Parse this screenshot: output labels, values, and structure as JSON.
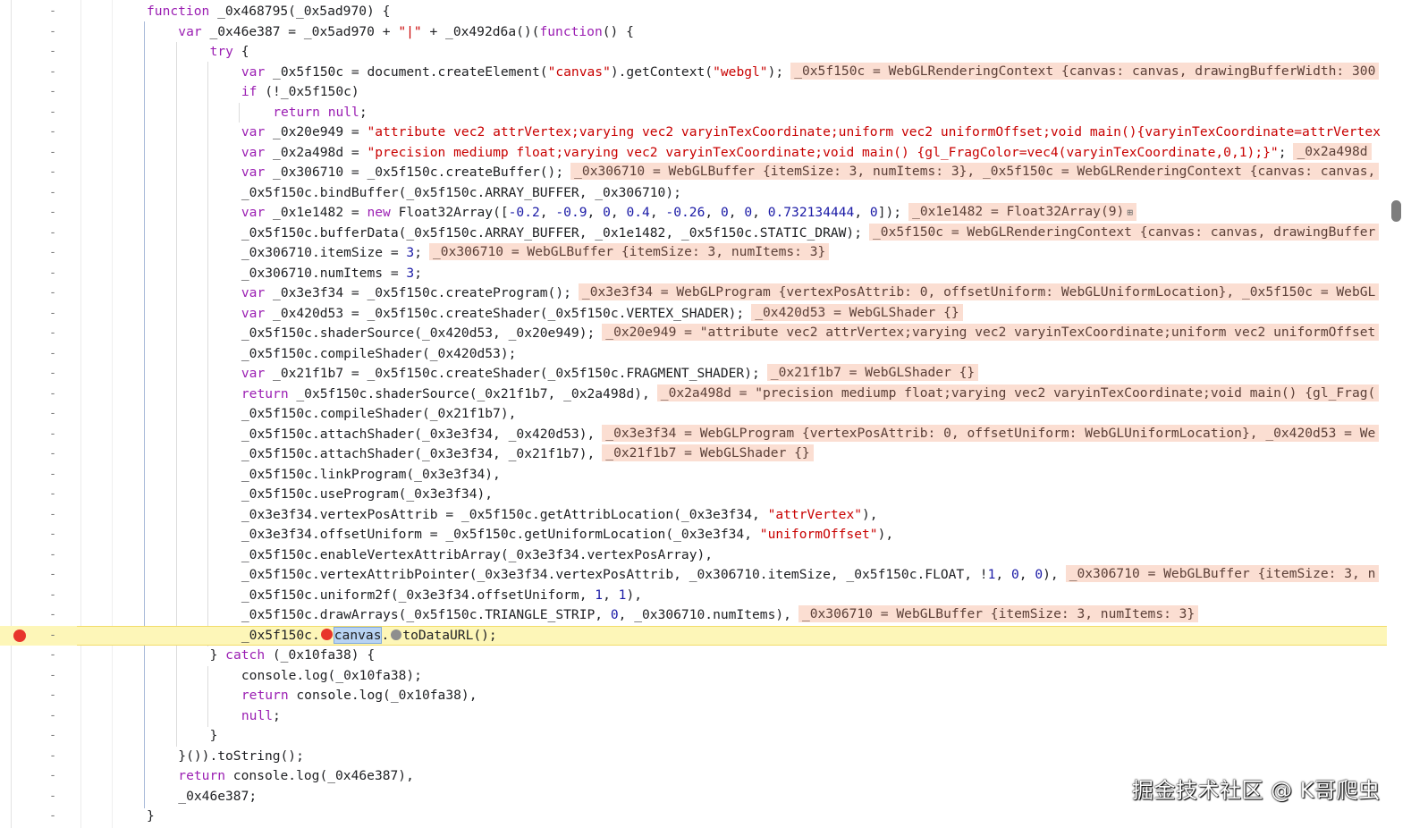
{
  "editor": {
    "paused_line_index": 31,
    "lines": [
      {
        "indent": 0,
        "marker": "-",
        "tokens": [
          {
            "k": "k",
            "t": "function"
          },
          {
            "k": "p",
            "t": " _0x468795(_0x5ad970) {"
          }
        ],
        "inline": null
      },
      {
        "indent": 1,
        "marker": "-",
        "tokens": [
          {
            "k": "k",
            "t": "var"
          },
          {
            "k": "p",
            "t": " _0x46e387 = _0x5ad970 + "
          },
          {
            "k": "s",
            "t": "\"|\""
          },
          {
            "k": "p",
            "t": " + _0x492d6a()("
          },
          {
            "k": "k",
            "t": "function"
          },
          {
            "k": "p",
            "t": "() {"
          }
        ],
        "inline": null
      },
      {
        "indent": 2,
        "marker": "-",
        "tokens": [
          {
            "k": "k",
            "t": "try"
          },
          {
            "k": "p",
            "t": " {"
          }
        ],
        "inline": null
      },
      {
        "indent": 3,
        "marker": "-",
        "tokens": [
          {
            "k": "k",
            "t": "var"
          },
          {
            "k": "p",
            "t": " _0x5f150c = document.createElement("
          },
          {
            "k": "s",
            "t": "\"canvas\""
          },
          {
            "k": "p",
            "t": ").getContext("
          },
          {
            "k": "s",
            "t": "\"webgl\""
          },
          {
            "k": "p",
            "t": ");"
          }
        ],
        "inline": "_0x5f150c = WebGLRenderingContext {canvas: canvas, drawingBufferWidth: 300"
      },
      {
        "indent": 3,
        "marker": "-",
        "tokens": [
          {
            "k": "k",
            "t": "if"
          },
          {
            "k": "p",
            "t": " (!_0x5f150c)"
          }
        ],
        "inline": null
      },
      {
        "indent": 4,
        "marker": "-",
        "tokens": [
          {
            "k": "k",
            "t": "return"
          },
          {
            "k": "p",
            "t": " "
          },
          {
            "k": "k",
            "t": "null"
          },
          {
            "k": "p",
            "t": ";"
          }
        ],
        "inline": null
      },
      {
        "indent": 3,
        "marker": "-",
        "tokens": [
          {
            "k": "k",
            "t": "var"
          },
          {
            "k": "p",
            "t": " _0x20e949 = "
          },
          {
            "k": "s",
            "t": "\"attribute vec2 attrVertex;varying vec2 varyinTexCoordinate;uniform vec2 uniformOffset;void main(){varyinTexCoordinate=attrVertex"
          }
        ],
        "inline": null
      },
      {
        "indent": 3,
        "marker": "-",
        "tokens": [
          {
            "k": "k",
            "t": "var"
          },
          {
            "k": "p",
            "t": " _0x2a498d = "
          },
          {
            "k": "s",
            "t": "\"precision mediump float;varying vec2 varyinTexCoordinate;void main() {gl_FragColor=vec4(varyinTexCoordinate,0,1);}\""
          },
          {
            "k": "p",
            "t": ";"
          }
        ],
        "inline": "_0x2a498d"
      },
      {
        "indent": 3,
        "marker": "-",
        "tokens": [
          {
            "k": "k",
            "t": "var"
          },
          {
            "k": "p",
            "t": " _0x306710 = _0x5f150c.createBuffer();"
          }
        ],
        "inline": "_0x306710 = WebGLBuffer {itemSize: 3, numItems: 3}, _0x5f150c = WebGLRenderingContext {canvas: canvas,"
      },
      {
        "indent": 3,
        "marker": "-",
        "tokens": [
          {
            "k": "p",
            "t": "_0x5f150c.bindBuffer(_0x5f150c.ARRAY_BUFFER, _0x306710);"
          }
        ],
        "inline": null
      },
      {
        "indent": 3,
        "marker": "-",
        "tokens": [
          {
            "k": "k",
            "t": "var"
          },
          {
            "k": "p",
            "t": " _0x1e1482 = "
          },
          {
            "k": "k",
            "t": "new"
          },
          {
            "k": "p",
            "t": " Float32Array(["
          },
          {
            "k": "n",
            "t": "-0.2"
          },
          {
            "k": "p",
            "t": ", "
          },
          {
            "k": "n",
            "t": "-0.9"
          },
          {
            "k": "p",
            "t": ", "
          },
          {
            "k": "n",
            "t": "0"
          },
          {
            "k": "p",
            "t": ", "
          },
          {
            "k": "n",
            "t": "0.4"
          },
          {
            "k": "p",
            "t": ", "
          },
          {
            "k": "n",
            "t": "-0.26"
          },
          {
            "k": "p",
            "t": ", "
          },
          {
            "k": "n",
            "t": "0"
          },
          {
            "k": "p",
            "t": ", "
          },
          {
            "k": "n",
            "t": "0"
          },
          {
            "k": "p",
            "t": ", "
          },
          {
            "k": "n",
            "t": "0.732134444"
          },
          {
            "k": "p",
            "t": ", "
          },
          {
            "k": "n",
            "t": "0"
          },
          {
            "k": "p",
            "t": "]);"
          }
        ],
        "inline": "_0x1e1482 = Float32Array(9)",
        "inline_icon": "⊞"
      },
      {
        "indent": 3,
        "marker": "-",
        "tokens": [
          {
            "k": "p",
            "t": "_0x5f150c.bufferData(_0x5f150c.ARRAY_BUFFER, _0x1e1482, _0x5f150c.STATIC_DRAW);"
          }
        ],
        "inline": "_0x5f150c = WebGLRenderingContext {canvas: canvas, drawingBuffer"
      },
      {
        "indent": 3,
        "marker": "-",
        "tokens": [
          {
            "k": "p",
            "t": "_0x306710.itemSize = "
          },
          {
            "k": "n",
            "t": "3"
          },
          {
            "k": "p",
            "t": ";"
          }
        ],
        "inline": "_0x306710 = WebGLBuffer {itemSize: 3, numItems: 3}"
      },
      {
        "indent": 3,
        "marker": "-",
        "tokens": [
          {
            "k": "p",
            "t": "_0x306710.numItems = "
          },
          {
            "k": "n",
            "t": "3"
          },
          {
            "k": "p",
            "t": ";"
          }
        ],
        "inline": null
      },
      {
        "indent": 3,
        "marker": "-",
        "tokens": [
          {
            "k": "k",
            "t": "var"
          },
          {
            "k": "p",
            "t": " _0x3e3f34 = _0x5f150c.createProgram();"
          }
        ],
        "inline": "_0x3e3f34 = WebGLProgram {vertexPosAttrib: 0, offsetUniform: WebGLUniformLocation}, _0x5f150c = WebGL"
      },
      {
        "indent": 3,
        "marker": "-",
        "tokens": [
          {
            "k": "k",
            "t": "var"
          },
          {
            "k": "p",
            "t": " _0x420d53 = _0x5f150c.createShader(_0x5f150c.VERTEX_SHADER);"
          }
        ],
        "inline": "_0x420d53 = WebGLShader {}"
      },
      {
        "indent": 3,
        "marker": "-",
        "tokens": [
          {
            "k": "p",
            "t": "_0x5f150c.shaderSource(_0x420d53, _0x20e949);"
          }
        ],
        "inline": "_0x20e949 = \"attribute vec2 attrVertex;varying vec2 varyinTexCoordinate;uniform vec2 uniformOffset"
      },
      {
        "indent": 3,
        "marker": "-",
        "tokens": [
          {
            "k": "p",
            "t": "_0x5f150c.compileShader(_0x420d53);"
          }
        ],
        "inline": null
      },
      {
        "indent": 3,
        "marker": "-",
        "tokens": [
          {
            "k": "k",
            "t": "var"
          },
          {
            "k": "p",
            "t": " _0x21f1b7 = _0x5f150c.createShader(_0x5f150c.FRAGMENT_SHADER);"
          }
        ],
        "inline": "_0x21f1b7 = WebGLShader {}"
      },
      {
        "indent": 3,
        "marker": "-",
        "tokens": [
          {
            "k": "k",
            "t": "return"
          },
          {
            "k": "p",
            "t": " _0x5f150c.shaderSource(_0x21f1b7, _0x2a498d),"
          }
        ],
        "inline": "_0x2a498d = \"precision mediump float;varying vec2 varyinTexCoordinate;void main() {gl_Frag("
      },
      {
        "indent": 3,
        "marker": "-",
        "tokens": [
          {
            "k": "p",
            "t": "_0x5f150c.compileShader(_0x21f1b7),"
          }
        ],
        "inline": null
      },
      {
        "indent": 3,
        "marker": "-",
        "tokens": [
          {
            "k": "p",
            "t": "_0x5f150c.attachShader(_0x3e3f34, _0x420d53),"
          }
        ],
        "inline": "_0x3e3f34 = WebGLProgram {vertexPosAttrib: 0, offsetUniform: WebGLUniformLocation}, _0x420d53 = We"
      },
      {
        "indent": 3,
        "marker": "-",
        "tokens": [
          {
            "k": "p",
            "t": "_0x5f150c.attachShader(_0x3e3f34, _0x21f1b7),"
          }
        ],
        "inline": "_0x21f1b7 = WebGLShader {}"
      },
      {
        "indent": 3,
        "marker": "-",
        "tokens": [
          {
            "k": "p",
            "t": "_0x5f150c.linkProgram(_0x3e3f34),"
          }
        ],
        "inline": null
      },
      {
        "indent": 3,
        "marker": "-",
        "tokens": [
          {
            "k": "p",
            "t": "_0x5f150c.useProgram(_0x3e3f34),"
          }
        ],
        "inline": null
      },
      {
        "indent": 3,
        "marker": "-",
        "tokens": [
          {
            "k": "p",
            "t": "_0x3e3f34.vertexPosAttrib = _0x5f150c.getAttribLocation(_0x3e3f34, "
          },
          {
            "k": "s",
            "t": "\"attrVertex\""
          },
          {
            "k": "p",
            "t": "),"
          }
        ],
        "inline": null
      },
      {
        "indent": 3,
        "marker": "-",
        "tokens": [
          {
            "k": "p",
            "t": "_0x3e3f34.offsetUniform = _0x5f150c.getUniformLocation(_0x3e3f34, "
          },
          {
            "k": "s",
            "t": "\"uniformOffset\""
          },
          {
            "k": "p",
            "t": "),"
          }
        ],
        "inline": null
      },
      {
        "indent": 3,
        "marker": "-",
        "tokens": [
          {
            "k": "p",
            "t": "_0x5f150c.enableVertexAttribArray(_0x3e3f34.vertexPosArray),"
          }
        ],
        "inline": null
      },
      {
        "indent": 3,
        "marker": "-",
        "tokens": [
          {
            "k": "p",
            "t": "_0x5f150c.vertexAttribPointer(_0x3e3f34.vertexPosAttrib, _0x306710.itemSize, _0x5f150c.FLOAT, !"
          },
          {
            "k": "n",
            "t": "1"
          },
          {
            "k": "p",
            "t": ", "
          },
          {
            "k": "n",
            "t": "0"
          },
          {
            "k": "p",
            "t": ", "
          },
          {
            "k": "n",
            "t": "0"
          },
          {
            "k": "p",
            "t": "),"
          }
        ],
        "inline": "_0x306710 = WebGLBuffer {itemSize: 3, n"
      },
      {
        "indent": 3,
        "marker": "-",
        "tokens": [
          {
            "k": "p",
            "t": "_0x5f150c.uniform2f(_0x3e3f34.offsetUniform, "
          },
          {
            "k": "n",
            "t": "1"
          },
          {
            "k": "p",
            "t": ", "
          },
          {
            "k": "n",
            "t": "1"
          },
          {
            "k": "p",
            "t": "),"
          }
        ],
        "inline": null
      },
      {
        "indent": 3,
        "marker": "-",
        "tokens": [
          {
            "k": "p",
            "t": "_0x5f150c.drawArrays(_0x5f150c.TRIANGLE_STRIP, "
          },
          {
            "k": "n",
            "t": "0"
          },
          {
            "k": "p",
            "t": ", _0x306710.numItems),"
          }
        ],
        "inline": "_0x306710 = WebGLBuffer {itemSize: 3, numItems: 3}"
      },
      {
        "indent": 3,
        "marker": "-",
        "breakpoint": true,
        "tokens": [
          {
            "k": "p",
            "t": "_0x5f150c."
          },
          {
            "k": "reddot",
            "t": ""
          },
          {
            "k": "sel",
            "t": "canvas"
          },
          {
            "k": "p",
            "t": "."
          },
          {
            "k": "greydot",
            "t": ""
          },
          {
            "k": "p",
            "t": "toDataURL();"
          }
        ],
        "inline": null
      },
      {
        "indent": 2,
        "marker": "-",
        "tokens": [
          {
            "k": "p",
            "t": "} "
          },
          {
            "k": "k",
            "t": "catch"
          },
          {
            "k": "p",
            "t": " (_0x10fa38) {"
          }
        ],
        "inline": null
      },
      {
        "indent": 3,
        "marker": "-",
        "tokens": [
          {
            "k": "p",
            "t": "console.log(_0x10fa38);"
          }
        ],
        "inline": null
      },
      {
        "indent": 3,
        "marker": "-",
        "tokens": [
          {
            "k": "k",
            "t": "return"
          },
          {
            "k": "p",
            "t": " console.log(_0x10fa38),"
          }
        ],
        "inline": null
      },
      {
        "indent": 3,
        "marker": "-",
        "tokens": [
          {
            "k": "k",
            "t": "null"
          },
          {
            "k": "p",
            "t": ";"
          }
        ],
        "inline": null
      },
      {
        "indent": 2,
        "marker": "-",
        "tokens": [
          {
            "k": "p",
            "t": "}"
          }
        ],
        "inline": null
      },
      {
        "indent": 1,
        "marker": "-",
        "tokens": [
          {
            "k": "p",
            "t": "}()).toString();"
          }
        ],
        "inline": null
      },
      {
        "indent": 1,
        "marker": "-",
        "tokens": [
          {
            "k": "k",
            "t": "return"
          },
          {
            "k": "p",
            "t": " console.log(_0x46e387),"
          }
        ],
        "inline": null
      },
      {
        "indent": 1,
        "marker": "-",
        "tokens": [
          {
            "k": "p",
            "t": "_0x46e387;"
          }
        ],
        "inline": null
      },
      {
        "indent": 0,
        "marker": "-",
        "tokens": [
          {
            "k": "p",
            "t": "}"
          }
        ],
        "inline": null
      }
    ]
  },
  "watermark": {
    "text": "掘金技术社区 @ K哥爬虫"
  },
  "colors": {
    "keyword": "#9b1fb3",
    "string": "#c80000",
    "number": "#1a1aa6",
    "inline_value_bg": "#fbded2",
    "paused_line_bg": "#fdf6b8",
    "breakpoint": "#e8352b"
  }
}
